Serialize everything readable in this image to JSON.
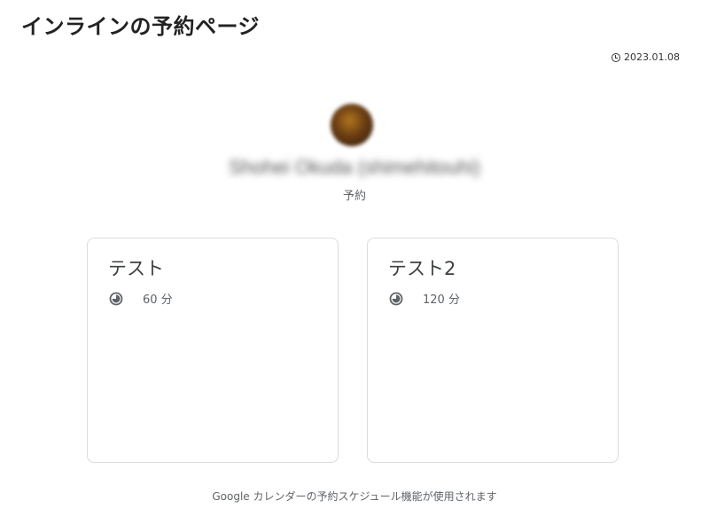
{
  "page": {
    "title": "インラインの予約ページ",
    "date": "2023.01.08",
    "date_icon": "clock-icon"
  },
  "host": {
    "name": "Shohei Okuda (shimehitouhi)",
    "subtitle": "予約"
  },
  "cards": [
    {
      "title": "テスト",
      "duration": "60 分",
      "icon": "timer-icon"
    },
    {
      "title": "テスト2",
      "duration": "120 分",
      "icon": "timer-icon"
    }
  ],
  "footer": {
    "text": "Google カレンダーの予約スケジュール機能が使用されます"
  }
}
